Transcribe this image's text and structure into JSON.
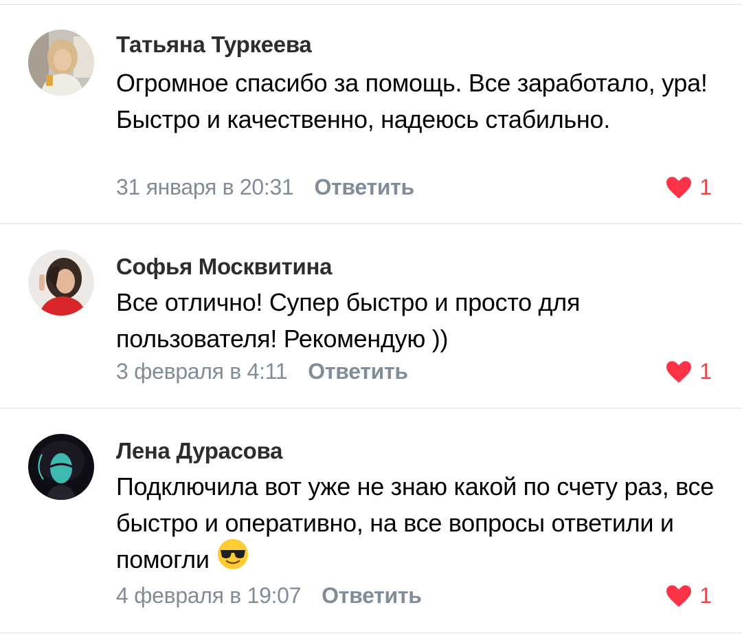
{
  "colors": {
    "author": "#2c2d2e",
    "text": "#000000",
    "meta": "#818c99",
    "like": "#ff3347",
    "divider": "#dcdfe3"
  },
  "comments": [
    {
      "author": "Татьяна Туркеева",
      "text": "Огромное спасибо за помощь. Все заработало, ура! Быстро и качественно, надеюсь стабильно.",
      "date": "31 января в 20:31",
      "reply_label": "Ответить",
      "likes": "1",
      "like_icon": "heart-icon"
    },
    {
      "author": "Софья Москвитина",
      "text": "Все отлично! Супер быстро и просто для пользователя! Рекомендую ))",
      "date": "3 февраля в 4:11",
      "reply_label": "Ответить",
      "likes": "1",
      "like_icon": "heart-icon"
    },
    {
      "author": "Лена Дурасова",
      "text": "Подключила вот уже не знаю какой по счету раз, все быстро и оперативно, на все вопросы ответили и помогли",
      "emoji": "sunglasses-emoji-icon",
      "date": "4 февраля в 19:07",
      "reply_label": "Ответить",
      "likes": "1",
      "like_icon": "heart-icon"
    }
  ]
}
